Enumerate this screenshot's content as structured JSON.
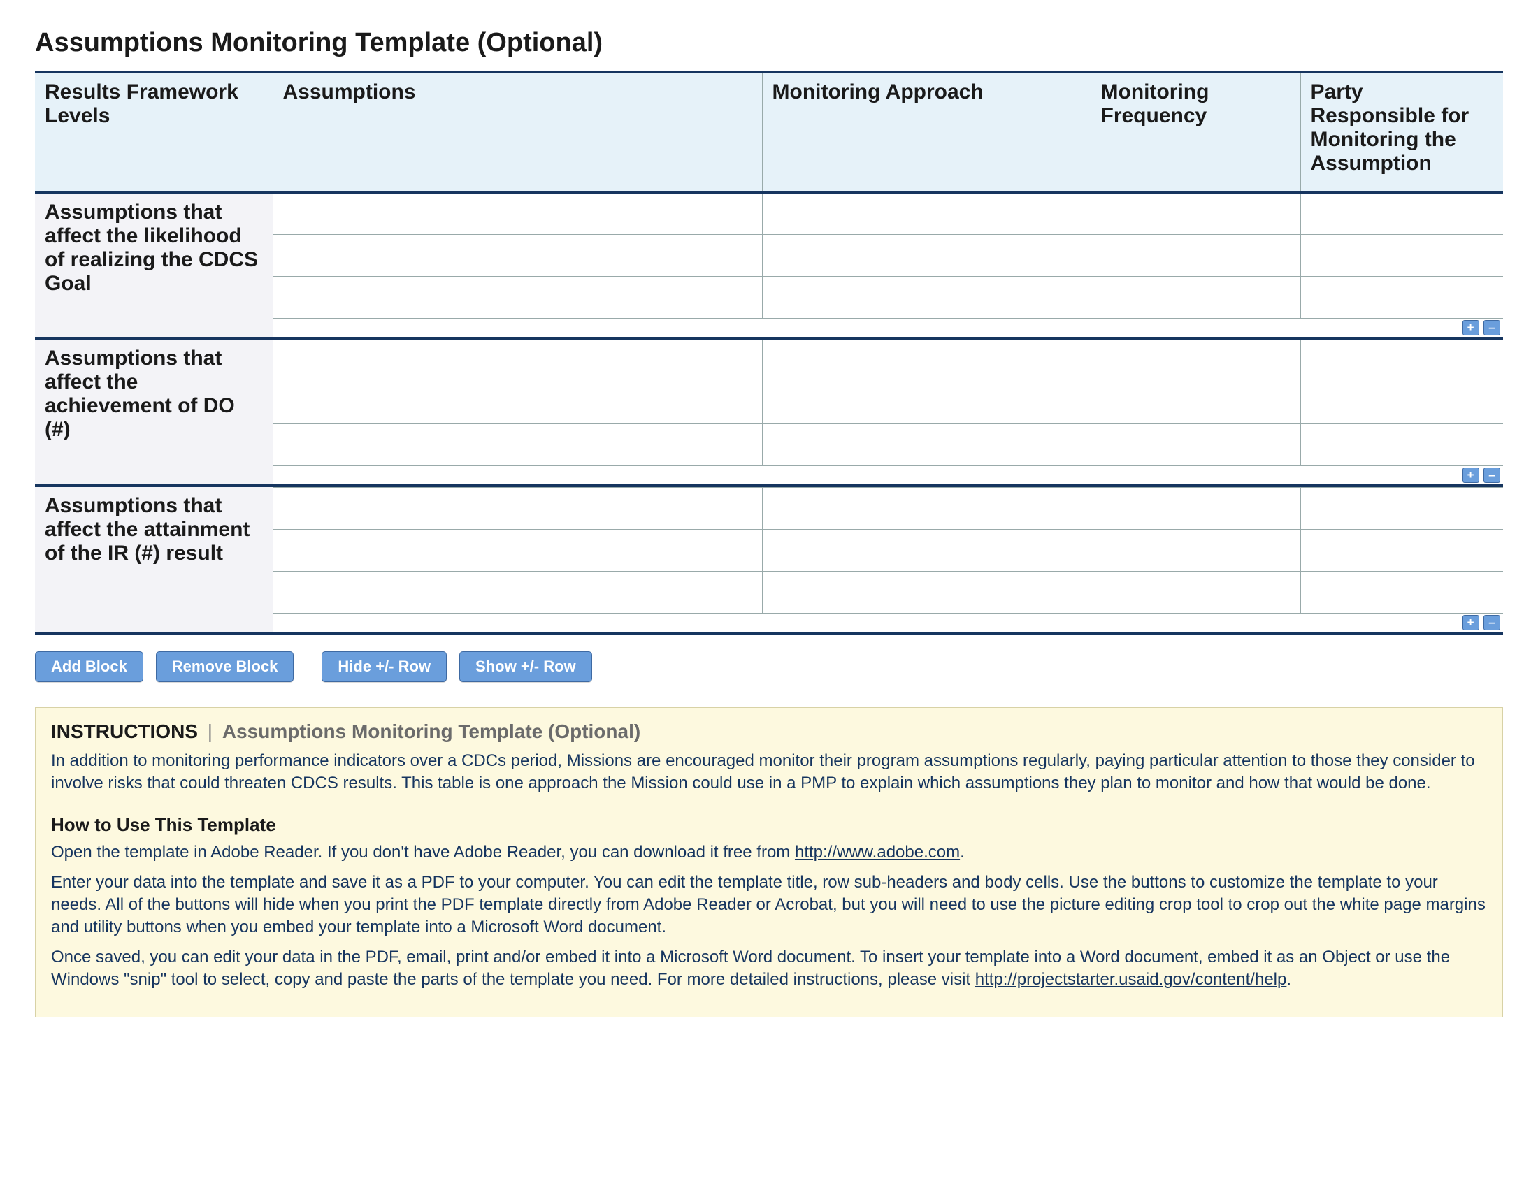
{
  "title": "Assumptions Monitoring Template (Optional)",
  "columns": {
    "c1": "Results Framework Levels",
    "c2": "Assumptions",
    "c3": "Monitoring Approach",
    "c4": "Monitoring Frequency",
    "c5": "Party Responsible for Monitoring the Assumption"
  },
  "sections": {
    "s1": "Assumptions that affect the likelihood of realizing the CDCS Goal",
    "s2": "Assumptions that affect the achievement of DO (#)",
    "s3": "Assumptions that affect the attainment of the IR (#) result"
  },
  "row_controls": {
    "add": "+",
    "remove": "–"
  },
  "toolbar": {
    "add_block": "Add Block",
    "remove_block": "Remove Block",
    "hide_row": "Hide +/- Row",
    "show_row": "Show +/- Row"
  },
  "instructions": {
    "label": "INSTRUCTIONS",
    "subtitle": "Assumptions Monitoring Template (Optional)",
    "p1": "In addition to monitoring performance indicators over a CDCs period, Missions are encouraged monitor their program assumptions regularly, paying particular attention to those they consider to involve risks that could threaten CDCS results. This table is one approach the Mission could use in a PMP to explain which assumptions they plan to monitor and how that would be done.",
    "howto_title": "How to Use This Template",
    "p2a": "Open the template in Adobe Reader. If you don't have Adobe Reader, you can download it free from ",
    "link1": "http://www.adobe.com",
    "p2b": ".",
    "p3": "Enter your data into the template and save it as a PDF to your computer. You can edit the template title, row sub-headers and body cells. Use the buttons to customize the template to your needs. All of the buttons will hide when you print the PDF template directly from Adobe Reader or Acrobat, but you will need to use the picture editing crop tool to crop out the white page margins and utility buttons when you embed your template into a Microsoft Word document.",
    "p4a": "Once saved, you can edit your data in the PDF, email, print and/or embed it into a Microsoft Word document. To insert your template into a Word document, embed it as an Object or use the Windows \"snip\" tool to select, copy and paste the parts of the template you need. For more detailed instructions, please visit ",
    "link2": "http://projectstarter.usaid.gov/content/help",
    "p4b": "."
  }
}
